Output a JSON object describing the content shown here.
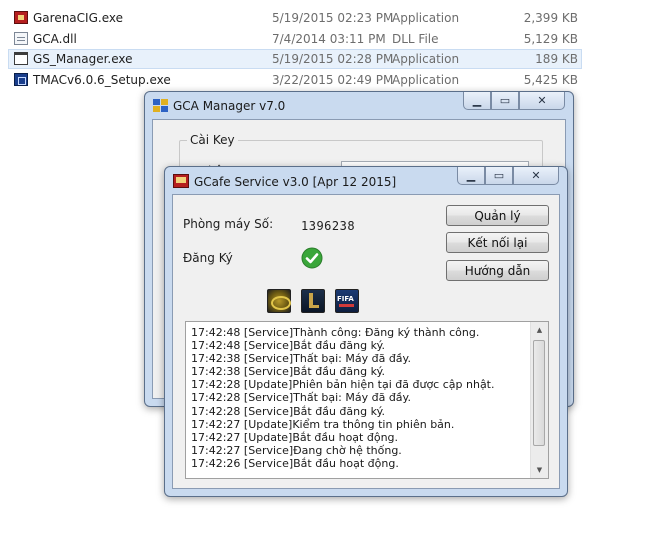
{
  "explorer": {
    "files": [
      {
        "name": "GarenaCIG.exe",
        "date": "5/19/2015 02:23 PM",
        "type": "Application",
        "size": "2,399 KB",
        "icon": "application-icon"
      },
      {
        "name": "GCA.dll",
        "date": "7/4/2014 03:11 PM",
        "type": "DLL File",
        "size": "5,129 KB",
        "icon": "dll-file-icon"
      },
      {
        "name": "GS_Manager.exe",
        "date": "5/19/2015 02:28 PM",
        "type": "Application",
        "size": "189 KB",
        "icon": "window-app-icon"
      },
      {
        "name": "TMACv6.0.6_Setup.exe",
        "date": "3/22/2015 02:49 PM",
        "type": "Application",
        "size": "5,425 KB",
        "icon": "setup-icon"
      }
    ]
  },
  "gca_window": {
    "title": "GCA Manager v7.0",
    "group_label": "Cài Key",
    "partial_label": "Nhập Key"
  },
  "gcafe_window": {
    "title": "GCafe Service v3.0 [Apr 12 2015]",
    "room_label": "Phòng máy Số:",
    "room_number": "1396238",
    "register_label": "Đăng Ký",
    "buttons": {
      "manage": "Quản lý",
      "reconnect": "Kết nối lại",
      "guide": "Hướng dẫn"
    },
    "game_icons": [
      "fifa-online-icon",
      "league-of-legends-icon",
      "fifa-online-3-icon"
    ],
    "game_icon_texts": {
      "third": "FIFA"
    },
    "log": [
      "17:42:48 [Service]Thành công: Đăng ký thành công.",
      "17:42:48 [Service]Bắt đầu đăng ký.",
      "17:42:38 [Service]Thất bại: Máy đã đầy.",
      "17:42:38 [Service]Bắt đầu đăng ký.",
      "17:42:28 [Update]Phiên bản hiện tại đã được cập nhật.",
      "17:42:28 [Service]Thất bại: Máy đã đầy.",
      "17:42:28 [Service]Bắt đầu đăng ký.",
      "17:42:27 [Update]Kiểm tra thông tin phiên bản.",
      "17:42:27 [Update]Bắt đầu hoạt động.",
      "17:42:27 [Service]Đang chờ hệ thống.",
      "17:42:26 [Service]Bắt đầu hoạt động."
    ]
  },
  "colors": {
    "window_frame": "#c9daef",
    "client_bg": "#f0f0f0",
    "selected_row": "#e8f1fb",
    "check_green": "#3aa63a"
  }
}
